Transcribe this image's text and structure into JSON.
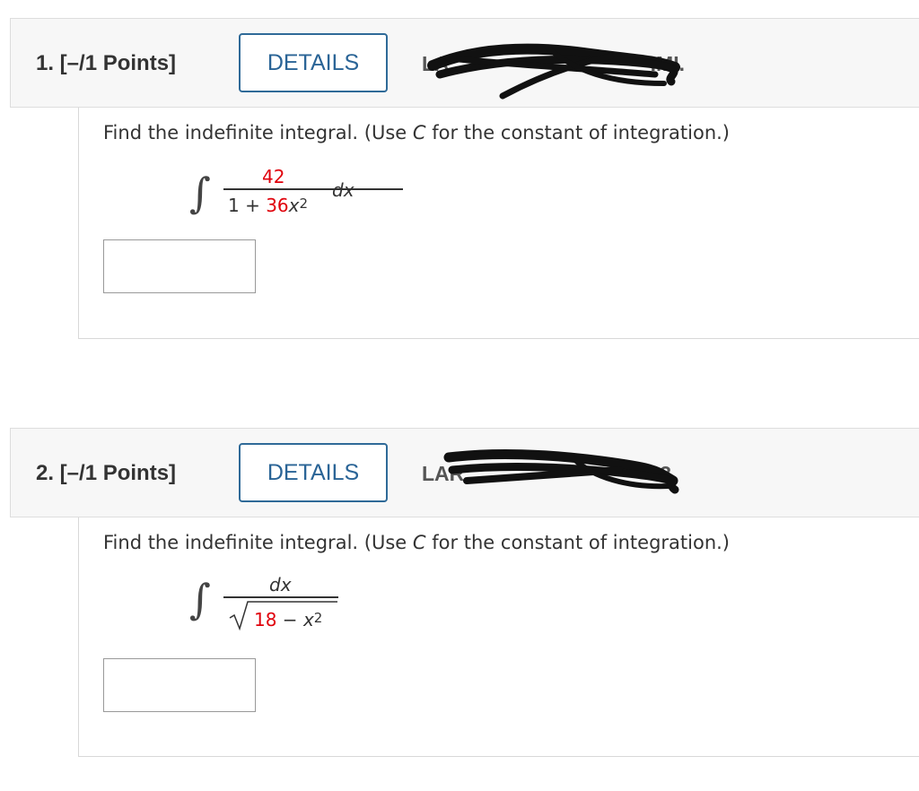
{
  "questions": [
    {
      "title": "1. [–/1 Points]",
      "details_label": "DETAILS",
      "code_visible": "LA",
      "code_tail": ".MI.",
      "prompt_before_c": "Find the indefinite integral. (Use ",
      "prompt_c": "C",
      "prompt_after_c": " for the constant of integration.)",
      "math": {
        "numerator": "42",
        "denominator_const": "1 + ",
        "denominator_coef": "36",
        "denominator_var": "x",
        "denominator_exp": "2",
        "differential": "dx"
      },
      "answer_value": ""
    },
    {
      "title": "2. [–/1 Points]",
      "details_label": "DETAILS",
      "code_visible": "LAR",
      "code_tail": "3.",
      "prompt_before_c": "Find the indefinite integral. (Use ",
      "prompt_c": "C",
      "prompt_after_c": " for the constant of integration.)",
      "math": {
        "numerator": "dx",
        "radical_const": "18",
        "radical_op": " − ",
        "radical_var": "x",
        "radical_exp": "2"
      },
      "answer_value": ""
    }
  ],
  "colors": {
    "accent": "#2f6a98",
    "red_values": "#e0000b",
    "header_bg": "#f7f7f7"
  }
}
